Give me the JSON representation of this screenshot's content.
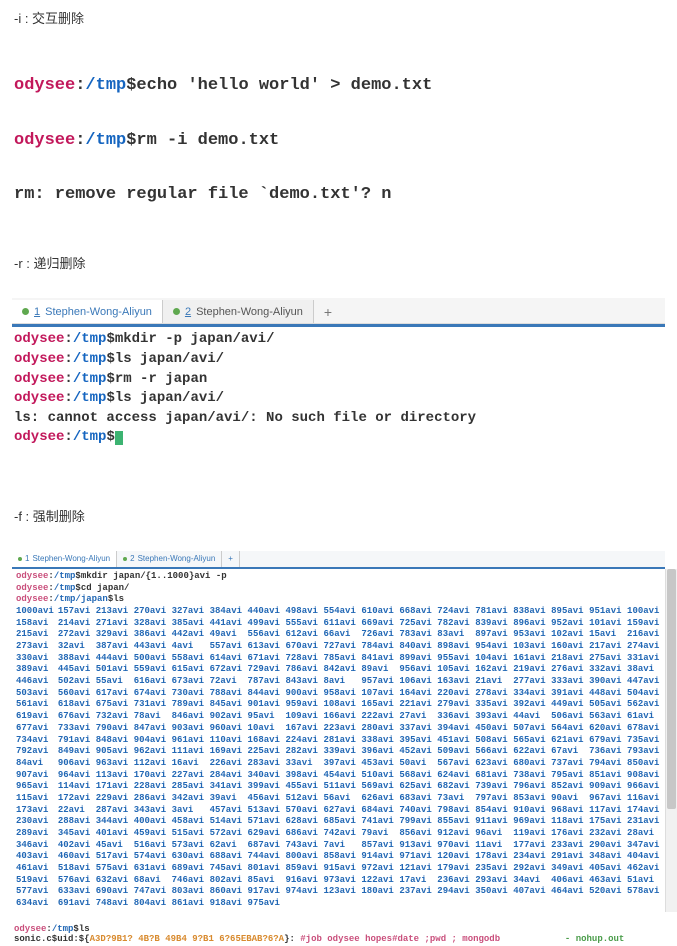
{
  "labels": {
    "section1": "-i : 交互删除",
    "section2": "-r : 递归删除",
    "section3": "-f : 强制删除"
  },
  "term1": {
    "user": "odysee",
    "path": "/tmp",
    "line1_cmd": "$echo 'hello world' > demo.txt",
    "line2_cmd": "$rm -i demo.txt",
    "line3_out": "rm: remove regular file `demo.txt'? n"
  },
  "tabs": {
    "t1_num": "1",
    "t1_label": "Stephen-Wong-Aliyun",
    "t2_num": "2",
    "t2_label": "Stephen-Wong-Aliyun",
    "add": "+"
  },
  "term2": {
    "user": "odysee",
    "path": "/tmp",
    "l1": "$mkdir -p japan/avi/",
    "l2": "$ls japan/avi/",
    "l3": "$rm -r japan",
    "l4": "$ls japan/avi/",
    "l5": "ls: cannot access japan/avi/: No such file or directory",
    "l6": "$"
  },
  "term3": {
    "user": "odysee",
    "path_tmp": "/tmp",
    "path_japan": "/tmp/japan",
    "l1": "$mkdir japan/{1..1000}avi -p",
    "l2": "$cd japan/",
    "l3": "$ls",
    "rows": [
      [
        "1000avi",
        "157avi",
        "213avi",
        "270avi",
        "327avi",
        "384avi",
        "440avi",
        "498avi",
        "554avi",
        "610avi",
        "668avi",
        "724avi",
        "781avi",
        "838avi",
        "895avi",
        "951avi"
      ],
      [
        "100avi",
        "158avi",
        "214avi",
        "271avi",
        "328avi",
        "385avi",
        "441avi",
        "499avi",
        "555avi",
        "611avi",
        "669avi",
        "725avi",
        "782avi",
        "839avi",
        "896avi",
        "952avi"
      ],
      [
        "101avi",
        "159avi",
        "215avi",
        "272avi",
        "329avi",
        "386avi",
        "442avi",
        "49avi",
        "556avi",
        "612avi",
        "66avi",
        "726avi",
        "783avi",
        "83avi",
        "897avi",
        "953avi"
      ],
      [
        "102avi",
        "15avi",
        "216avi",
        "273avi",
        "32avi",
        "387avi",
        "443avi",
        "4avi",
        "557avi",
        "613avi",
        "670avi",
        "727avi",
        "784avi",
        "840avi",
        "898avi",
        "954avi"
      ],
      [
        "103avi",
        "160avi",
        "217avi",
        "274avi",
        "330avi",
        "388avi",
        "444avi",
        "500avi",
        "558avi",
        "614avi",
        "671avi",
        "728avi",
        "785avi",
        "841avi",
        "899avi",
        "955avi"
      ],
      [
        "104avi",
        "161avi",
        "218avi",
        "275avi",
        "331avi",
        "389avi",
        "445avi",
        "501avi",
        "559avi",
        "615avi",
        "672avi",
        "729avi",
        "786avi",
        "842avi",
        "89avi",
        "956avi"
      ],
      [
        "105avi",
        "162avi",
        "219avi",
        "276avi",
        "332avi",
        "38avi",
        "446avi",
        "502avi",
        "55avi",
        "616avi",
        "673avi",
        "72avi",
        "787avi",
        "843avi",
        "8avi",
        "957avi"
      ],
      [
        "106avi",
        "163avi",
        "21avi",
        "277avi",
        "333avi",
        "390avi",
        "447avi",
        "503avi",
        "560avi",
        "617avi",
        "674avi",
        "730avi",
        "788avi",
        "844avi",
        "900avi",
        "958avi"
      ],
      [
        "107avi",
        "164avi",
        "220avi",
        "278avi",
        "334avi",
        "391avi",
        "448avi",
        "504avi",
        "561avi",
        "618avi",
        "675avi",
        "731avi",
        "789avi",
        "845avi",
        "901avi",
        "959avi"
      ],
      [
        "108avi",
        "165avi",
        "221avi",
        "279avi",
        "335avi",
        "392avi",
        "449avi",
        "505avi",
        "562avi",
        "619avi",
        "676avi",
        "732avi",
        "78avi",
        "846avi",
        "902avi",
        "95avi"
      ],
      [
        "109avi",
        "166avi",
        "222avi",
        "27avi",
        "336avi",
        "393avi",
        "44avi",
        "506avi",
        "563avi",
        "61avi",
        "677avi",
        "733avi",
        "790avi",
        "847avi",
        "903avi",
        "960avi"
      ],
      [
        "10avi",
        "167avi",
        "223avi",
        "280avi",
        "337avi",
        "394avi",
        "450avi",
        "507avi",
        "564avi",
        "620avi",
        "678avi",
        "734avi",
        "791avi",
        "848avi",
        "904avi",
        "961avi"
      ],
      [
        "110avi",
        "168avi",
        "224avi",
        "281avi",
        "338avi",
        "395avi",
        "451avi",
        "508avi",
        "565avi",
        "621avi",
        "679avi",
        "735avi",
        "792avi",
        "849avi",
        "905avi",
        "962avi"
      ],
      [
        "111avi",
        "169avi",
        "225avi",
        "282avi",
        "339avi",
        "396avi",
        "452avi",
        "509avi",
        "566avi",
        "622avi",
        "67avi",
        "736avi",
        "793avi",
        "84avi",
        "906avi",
        "963avi"
      ],
      [
        "112avi",
        "16avi",
        "226avi",
        "283avi",
        "33avi",
        "397avi",
        "453avi",
        "50avi",
        "567avi",
        "623avi",
        "680avi",
        "737avi",
        "794avi",
        "850avi",
        "907avi",
        "964avi"
      ],
      [
        "113avi",
        "170avi",
        "227avi",
        "284avi",
        "340avi",
        "398avi",
        "454avi",
        "510avi",
        "568avi",
        "624avi",
        "681avi",
        "738avi",
        "795avi",
        "851avi",
        "908avi",
        "965avi"
      ],
      [
        "114avi",
        "171avi",
        "228avi",
        "285avi",
        "341avi",
        "399avi",
        "455avi",
        "511avi",
        "569avi",
        "625avi",
        "682avi",
        "739avi",
        "796avi",
        "852avi",
        "909avi",
        "966avi"
      ],
      [
        "115avi",
        "172avi",
        "229avi",
        "286avi",
        "342avi",
        "39avi",
        "456avi",
        "512avi",
        "56avi",
        "626avi",
        "683avi",
        "73avi",
        "797avi",
        "853avi",
        "90avi",
        "967avi"
      ],
      [
        "116avi",
        "173avi",
        "22avi",
        "287avi",
        "343avi",
        "3avi",
        "457avi",
        "513avi",
        "570avi",
        "627avi",
        "684avi",
        "740avi",
        "798avi",
        "854avi",
        "910avi",
        "968avi"
      ],
      [
        "117avi",
        "174avi",
        "230avi",
        "288avi",
        "344avi",
        "400avi",
        "458avi",
        "514avi",
        "571avi",
        "628avi",
        "685avi",
        "741avi",
        "799avi",
        "855avi",
        "911avi",
        "969avi"
      ],
      [
        "118avi",
        "175avi",
        "231avi",
        "289avi",
        "345avi",
        "401avi",
        "459avi",
        "515avi",
        "572avi",
        "629avi",
        "686avi",
        "742avi",
        "79avi",
        "856avi",
        "912avi",
        "96avi"
      ],
      [
        "119avi",
        "176avi",
        "232avi",
        "28avi",
        "346avi",
        "402avi",
        "45avi",
        "516avi",
        "573avi",
        "62avi",
        "687avi",
        "743avi",
        "7avi",
        "857avi",
        "913avi",
        "970avi"
      ],
      [
        "11avi",
        "177avi",
        "233avi",
        "290avi",
        "347avi",
        "403avi",
        "460avi",
        "517avi",
        "574avi",
        "630avi",
        "688avi",
        "744avi",
        "800avi",
        "858avi",
        "914avi",
        "971avi"
      ],
      [
        "120avi",
        "178avi",
        "234avi",
        "291avi",
        "348avi",
        "404avi",
        "461avi",
        "518avi",
        "575avi",
        "631avi",
        "689avi",
        "745avi",
        "801avi",
        "859avi",
        "915avi",
        "972avi"
      ],
      [
        "121avi",
        "179avi",
        "235avi",
        "292avi",
        "349avi",
        "405avi",
        "462avi",
        "519avi",
        "576avi",
        "632avi",
        "68avi",
        "746avi",
        "802avi",
        "85avi",
        "916avi",
        "973avi"
      ],
      [
        "122avi",
        "17avi",
        "236avi",
        "293avi",
        "34avi",
        "406avi",
        "463avi",
        "51avi",
        "577avi",
        "633avi",
        "690avi",
        "747avi",
        "803avi",
        "860avi",
        "917avi",
        "974avi"
      ],
      [
        "123avi",
        "180avi",
        "237avi",
        "294avi",
        "350avi",
        "407avi",
        "464avi",
        "520avi",
        "578avi",
        "634avi",
        "691avi",
        "748avi",
        "804avi",
        "861avi",
        "918avi",
        "975avi"
      ]
    ]
  },
  "bottom": {
    "l1_cmd": "$ls",
    "l2_prefix": "sonic.c$uid:${",
    "l2_uuid": "A3D?9B1? 4B?B 49B4 9?B1 6?65EBAB?6?A",
    "l2_mid": "}:   ",
    "l2_job": "#job odysee   hopes#date      ;pwd   ; mongodb",
    "l2_end": "-   nohup.out"
  }
}
